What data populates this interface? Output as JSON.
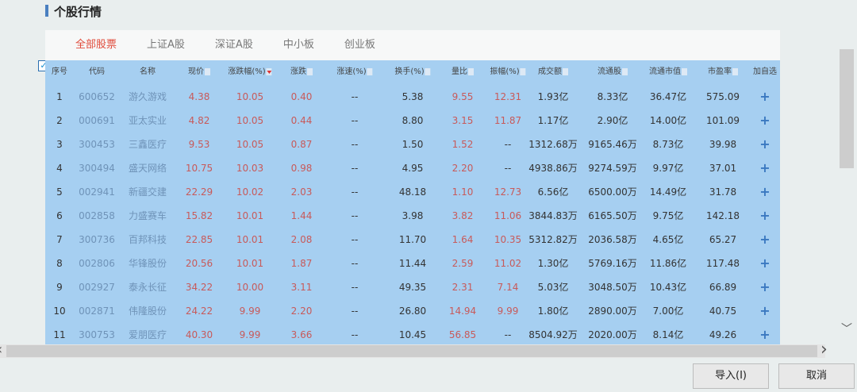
{
  "title": "个股行情",
  "tabs": [
    "全部股票",
    "上证A股",
    "深证A股",
    "中小板",
    "创业板"
  ],
  "headers": [
    "序号",
    "代码",
    "名称",
    "现价",
    "涨跌幅(%)",
    "涨跌",
    "涨速(%)",
    "换手(%)",
    "量比",
    "振幅(%)",
    "成交额",
    "流通股",
    "流通市值",
    "市盈率",
    "加自选"
  ],
  "sorted_column": "涨跌幅(%)",
  "rows": [
    [
      "1",
      "600652",
      "游久游戏",
      "4.38",
      "10.05",
      "0.40",
      "--",
      "5.38",
      "9.55",
      "12.31",
      "1.93亿",
      "8.33亿",
      "36.47亿",
      "575.09"
    ],
    [
      "2",
      "000691",
      "亚太实业",
      "4.82",
      "10.05",
      "0.44",
      "--",
      "8.80",
      "3.15",
      "11.87",
      "1.17亿",
      "2.90亿",
      "14.00亿",
      "101.09"
    ],
    [
      "3",
      "300453",
      "三鑫医疗",
      "9.53",
      "10.05",
      "0.87",
      "--",
      "1.50",
      "1.52",
      "--",
      "1312.68万",
      "9165.46万",
      "8.73亿",
      "39.98"
    ],
    [
      "4",
      "300494",
      "盛天网络",
      "10.75",
      "10.03",
      "0.98",
      "--",
      "4.95",
      "2.20",
      "--",
      "4938.86万",
      "9274.59万",
      "9.97亿",
      "37.01"
    ],
    [
      "5",
      "002941",
      "新疆交建",
      "22.29",
      "10.02",
      "2.03",
      "--",
      "48.18",
      "1.10",
      "12.73",
      "6.56亿",
      "6500.00万",
      "14.49亿",
      "31.78"
    ],
    [
      "6",
      "002858",
      "力盛赛车",
      "15.82",
      "10.01",
      "1.44",
      "--",
      "3.98",
      "3.82",
      "11.06",
      "3844.83万",
      "6165.50万",
      "9.75亿",
      "142.18"
    ],
    [
      "7",
      "300736",
      "百邦科技",
      "22.85",
      "10.01",
      "2.08",
      "--",
      "11.70",
      "1.64",
      "10.35",
      "5312.82万",
      "2036.58万",
      "4.65亿",
      "65.27"
    ],
    [
      "8",
      "002806",
      "华锋股份",
      "20.56",
      "10.01",
      "1.87",
      "--",
      "11.44",
      "2.59",
      "11.02",
      "1.30亿",
      "5769.16万",
      "11.86亿",
      "117.48"
    ],
    [
      "9",
      "002927",
      "泰永长征",
      "34.22",
      "10.00",
      "3.11",
      "--",
      "49.35",
      "2.31",
      "7.14",
      "5.03亿",
      "3048.50万",
      "10.43亿",
      "66.89"
    ],
    [
      "10",
      "002871",
      "伟隆股份",
      "24.22",
      "9.99",
      "2.20",
      "--",
      "26.80",
      "14.94",
      "9.99",
      "1.80亿",
      "2890.00万",
      "7.00亿",
      "40.75"
    ],
    [
      "11",
      "300753",
      "爱朋医疗",
      "40.30",
      "9.99",
      "3.66",
      "--",
      "10.45",
      "56.85",
      "--",
      "8504.92万",
      "2020.00万",
      "8.14亿",
      "49.26"
    ]
  ],
  "buttons": {
    "import": "导入(I)",
    "cancel": "取消"
  },
  "colors": {
    "accent": "#e04a3a",
    "table_bg": "#a6cff1",
    "up": "#c85a5a"
  }
}
